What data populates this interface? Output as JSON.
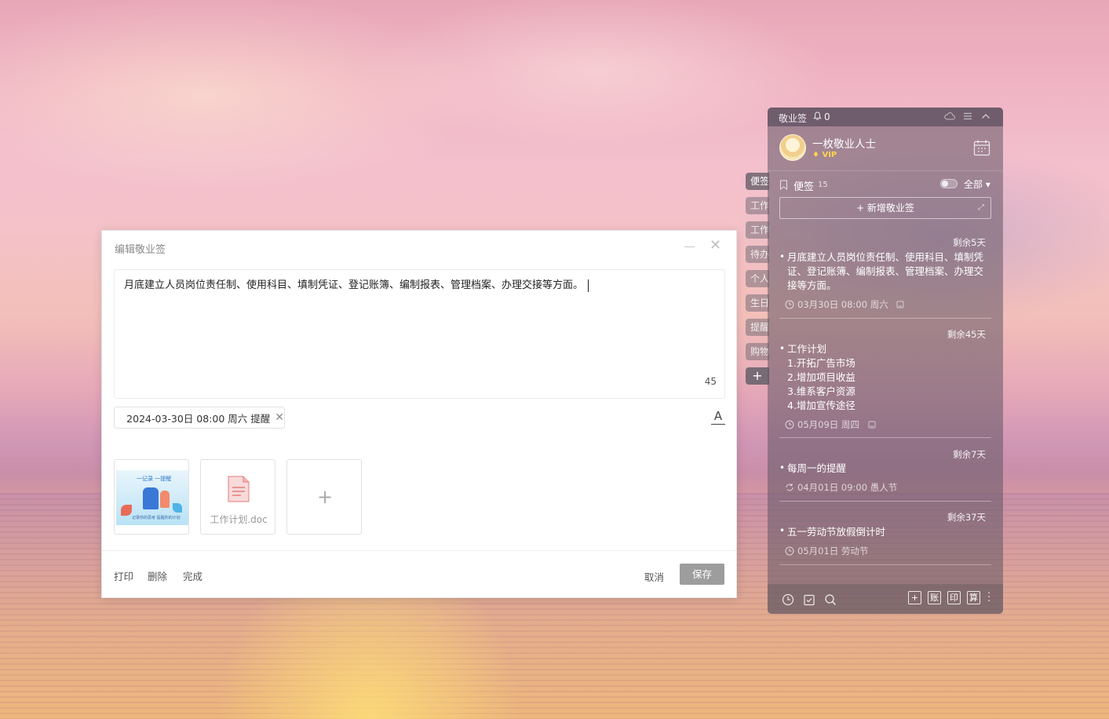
{
  "dialog": {
    "title": "编辑敬业签",
    "content": "月底建立人员岗位责任制、使用科目、填制凭证、登记账簿、编制报表、管理档案、办理交接等方面。",
    "char_count": "45",
    "reminder": "2024-03-30日 08:00 周六 提醒",
    "attachments": {
      "image_title": "一记录 一提醒",
      "image_caption": "记录你的思考 提醒你的计划",
      "doc_name": "工作计划.doc"
    },
    "footer": {
      "print": "打印",
      "delete": "删除",
      "done": "完成",
      "cancel": "取消",
      "save": "保存"
    }
  },
  "side_tabs": [
    "便签",
    "工作",
    "工作",
    "待办",
    "个人",
    "生日",
    "提醒",
    "购物",
    "+"
  ],
  "panel": {
    "app_name": "敬业签",
    "notification_count": "0",
    "user": {
      "name": "一枚敬业人士",
      "badge": "VIP"
    },
    "category": {
      "label": "便签",
      "count": "15",
      "filter": "全部"
    },
    "new_button": "+ 新增敬业签",
    "notes": [
      {
        "remaining": "剩余5天",
        "text": "月底建立人员岗位责任制、使用科目、填制凭证、登记账簿、编制报表、管理档案、办理交接等方面。",
        "meta": "03月30日 08:00 周六"
      },
      {
        "remaining": "剩余45天",
        "lines": [
          "工作计划",
          "1.开拓广告市场",
          "2.增加项目收益",
          "3.维系客户资源",
          "4.增加宣传途径"
        ],
        "meta": "05月09日 周四"
      },
      {
        "remaining": "剩余7天",
        "text": "每周一的提醒",
        "meta": "04月01日 09:00 愚人节"
      },
      {
        "remaining": "剩余37天",
        "text": "五一劳动节放假倒计时",
        "meta": "05月01日 劳动节"
      }
    ],
    "bottom_tools": {
      "add": "+",
      "ledger": "账",
      "print": "印",
      "calc": "算"
    }
  },
  "colors": {
    "save_button": "#9d9d9d",
    "vip": "#ffd34d",
    "panel_bg": "#605664"
  }
}
